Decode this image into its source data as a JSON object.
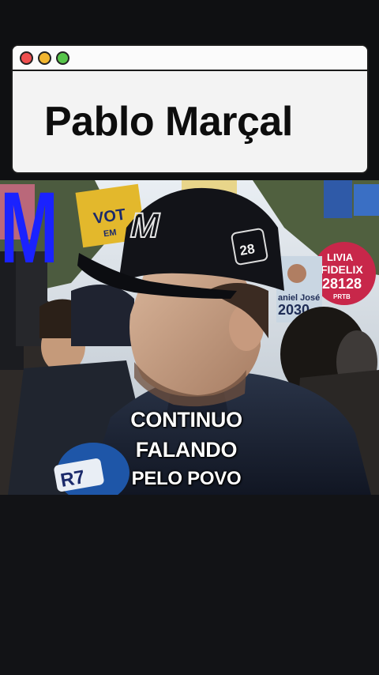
{
  "window": {
    "title": "Pablo Marçal",
    "controls": [
      "close-dot",
      "minimize-dot",
      "maximize-dot"
    ],
    "control_colors": {
      "close": "#ef4f4f",
      "minimize": "#f2b630",
      "maximize": "#57c54a"
    }
  },
  "video": {
    "caption": {
      "line1": "CONTINUO",
      "line2": "FALANDO",
      "line3": "PELO POVO"
    },
    "cap_emblem_letter": "M",
    "cap_badge_number": "28",
    "sign_text": {
      "vote": "VOT",
      "vote_sub": "EM",
      "candidate_name": "LIVIA",
      "candidate_surname": "FIDELIX",
      "candidate_number": "28128",
      "party": "PRTB",
      "other_sign": "aniel José",
      "other_number": "2030"
    },
    "mic_label": "R7",
    "channel_logo_letter": "M",
    "colors": {
      "logo_blue": "#1a22ff",
      "sign_pink": "#c8274a",
      "sign_yellow": "#e3b82c",
      "cap_black": "#121318"
    }
  }
}
